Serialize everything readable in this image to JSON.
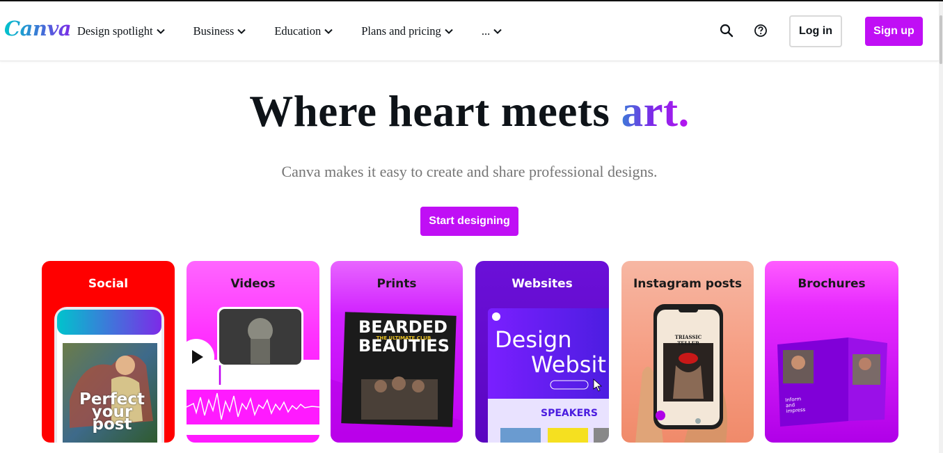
{
  "brand": {
    "logo_text": "Canva"
  },
  "nav": {
    "items": [
      {
        "label": "Design spotlight"
      },
      {
        "label": "Business"
      },
      {
        "label": "Education"
      },
      {
        "label": "Plans and pricing"
      },
      {
        "label": "..."
      }
    ],
    "search_icon": "search-icon",
    "help_icon": "help-circle-icon",
    "login_label": "Log in",
    "signup_label": "Sign up"
  },
  "hero": {
    "title_main": "Where heart meets ",
    "title_accent": "art.",
    "subtitle": "Canva makes it easy to create and share professional designs.",
    "cta_label": "Start designing"
  },
  "cards": [
    {
      "title": "Social",
      "overlay_text_1": "Perfect",
      "overlay_text_2": "your",
      "overlay_text_3": "post"
    },
    {
      "title": "Videos"
    },
    {
      "title": "Prints",
      "poster_title_1": "BEARDED",
      "poster_title_2": "BEAUTIES",
      "poster_tag": "THE ULTIMATE CLUB"
    },
    {
      "title": "Websites",
      "headline_1": "Design",
      "headline_2": "Websit",
      "section_label": "SPEAKERS"
    },
    {
      "title": "Instagram posts",
      "post_title": "TRIASSIC TELLER"
    },
    {
      "title": "Brochures",
      "brochure_text_1": "Inform",
      "brochure_text_2": "and",
      "brochure_text_3": "impress"
    }
  ],
  "colors": {
    "brand_purple": "#c00ff5",
    "text_dark": "#0e1318",
    "subtitle_gray": "#757575"
  }
}
